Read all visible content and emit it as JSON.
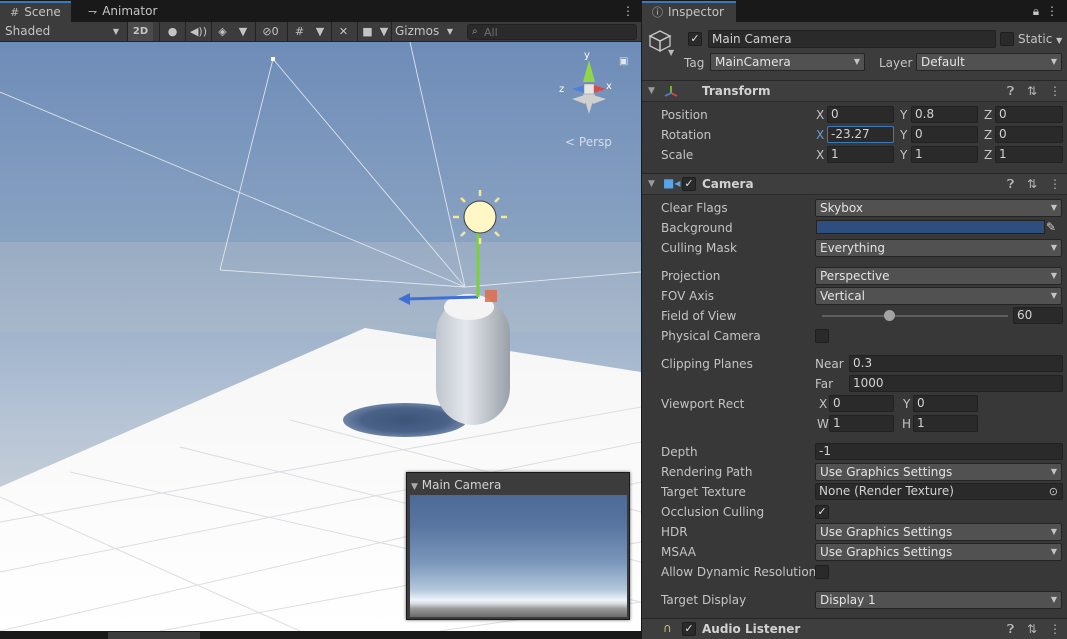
{
  "scene_panel": {
    "tabs": [
      {
        "label": "Scene",
        "icon": "grid-icon"
      },
      {
        "label": "Animator",
        "icon": "animator-icon"
      }
    ],
    "toolbar": {
      "draw_mode": "Shaded",
      "twod_label": "2D",
      "hidden_count": "0",
      "gizmos_label": "Gizmos",
      "search_placeholder": "All"
    },
    "viewport": {
      "projection_label": "Persp",
      "axis_labels": {
        "y": "y",
        "x": "x",
        "z": "z"
      }
    },
    "camera_preview": {
      "title": "Main Camera"
    },
    "bottom_strip_digits": "3"
  },
  "inspector": {
    "tab_label": "Inspector",
    "object": {
      "name": "Main Camera",
      "active": true,
      "static_label": "Static",
      "tag_label": "Tag",
      "tag_value": "MainCamera",
      "layer_label": "Layer",
      "layer_value": "Default"
    },
    "transform": {
      "title": "Transform",
      "position": {
        "label": "Position",
        "x": "0",
        "y": "0.8",
        "z": "0"
      },
      "rotation": {
        "label": "Rotation",
        "x": "-23.27",
        "y": "0",
        "z": "0"
      },
      "scale": {
        "label": "Scale",
        "x": "1",
        "y": "1",
        "z": "1"
      }
    },
    "camera": {
      "title": "Camera",
      "enabled": true,
      "clear_flags": {
        "label": "Clear Flags",
        "value": "Skybox"
      },
      "background": {
        "label": "Background",
        "color": "#2d4e7f"
      },
      "culling_mask": {
        "label": "Culling Mask",
        "value": "Everything"
      },
      "projection": {
        "label": "Projection",
        "value": "Perspective"
      },
      "fov_axis": {
        "label": "FOV Axis",
        "value": "Vertical"
      },
      "field_of_view": {
        "label": "Field of View",
        "value": "60",
        "slider_fraction": 0.36
      },
      "physical_camera": {
        "label": "Physical Camera",
        "checked": false
      },
      "clipping_planes": {
        "label": "Clipping Planes",
        "near_label": "Near",
        "near": "0.3",
        "far_label": "Far",
        "far": "1000"
      },
      "viewport_rect": {
        "label": "Viewport Rect",
        "x": "0",
        "y": "0",
        "w": "1",
        "h": "1"
      },
      "depth": {
        "label": "Depth",
        "value": "-1"
      },
      "rendering_path": {
        "label": "Rendering Path",
        "value": "Use Graphics Settings"
      },
      "target_texture": {
        "label": "Target Texture",
        "value": "None (Render Texture)"
      },
      "occlusion_culling": {
        "label": "Occlusion Culling",
        "checked": true
      },
      "hdr": {
        "label": "HDR",
        "value": "Use Graphics Settings"
      },
      "msaa": {
        "label": "MSAA",
        "value": "Use Graphics Settings"
      },
      "allow_dynamic_resolution": {
        "label": "Allow Dynamic Resolution",
        "checked": false
      },
      "target_display": {
        "label": "Target Display",
        "value": "Display 1"
      }
    },
    "audio_listener": {
      "title": "Audio Listener",
      "enabled": true
    },
    "colors": {
      "accent": "#3a79bb",
      "panel": "#383838",
      "field": "#2a2a2a"
    }
  }
}
